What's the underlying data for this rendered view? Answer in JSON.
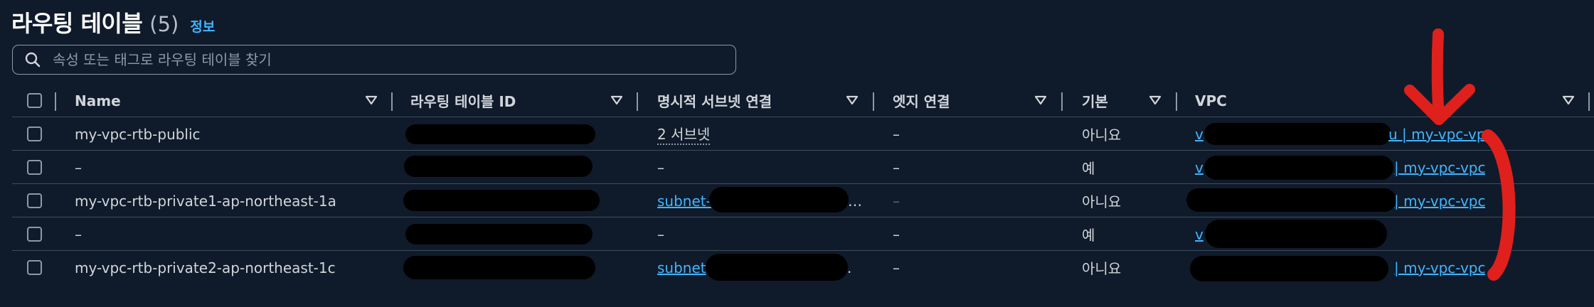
{
  "header": {
    "title": "라우팅 테이블",
    "count": "(5)",
    "info": "정보"
  },
  "search": {
    "placeholder": "속성 또는 태그로 라우팅 테이블 찾기",
    "value": ""
  },
  "columns": [
    "Name",
    "라우팅 테이블 ID",
    "명시적 서브넷 연결",
    "엣지 연결",
    "기본",
    "VPC"
  ],
  "rows": [
    {
      "name": "my-vpc-rtb-public",
      "subnet": "2 서브넷",
      "edge": "–",
      "main": "아니요",
      "vpc_prefix": "v",
      "vpc_suffix": "u | my-vpc-vpc"
    },
    {
      "name": "–",
      "subnet": "–",
      "edge": "–",
      "main": "예",
      "vpc_prefix": "v",
      "vpc_suffix": "| my-vpc-vpc"
    },
    {
      "name": "my-vpc-rtb-private1-ap-northeast-1a",
      "subnet": "subnet-",
      "subnet_tail": "…",
      "edge": "–",
      "main": "아니요",
      "vpc_prefix": "",
      "vpc_suffix": "| my-vpc-vpc"
    },
    {
      "name": "–",
      "subnet": "–",
      "edge": "–",
      "main": "예",
      "vpc_prefix": "v",
      "vpc_suffix": ""
    },
    {
      "name": "my-vpc-rtb-private2-ap-northeast-1c",
      "subnet": "subnet",
      "subnet_tail": ".",
      "edge": "–",
      "main": "아니요",
      "vpc_prefix": "",
      "vpc_suffix": "| my-vpc-vpc"
    }
  ],
  "colors": {
    "background": "#0f1b2a",
    "link": "#42b4ff",
    "annotation": "#e0201c"
  }
}
